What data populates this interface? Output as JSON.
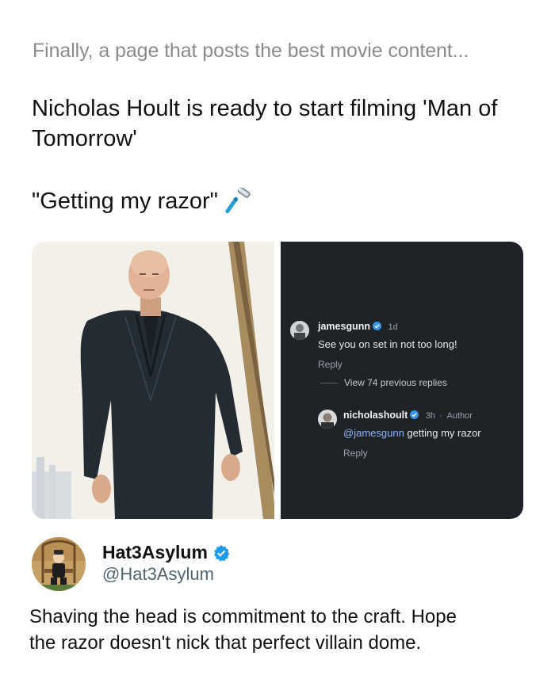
{
  "post": {
    "context_line": "Finally, a page that posts the best movie content...",
    "headline": "Nicholas Hoult is ready to start filming 'Man of Tomorrow'",
    "quote": "\"Getting my razor\"",
    "razor_icon": "razor-emoji"
  },
  "media": {
    "comments": [
      {
        "username": "jamesgunn",
        "verified": true,
        "age": "1d",
        "text": "See you on set in not too long!",
        "reply_label": "Reply"
      },
      {
        "username": "nicholashoult",
        "verified": true,
        "age": "3h",
        "role": "Author",
        "mention": "@jamesgunn",
        "text": "getting my razor",
        "reply_label": "Reply"
      }
    ],
    "view_replies": "View 74 previous replies",
    "separator": "·"
  },
  "reply": {
    "display_name": "Hat3Asylum",
    "handle": "@Hat3Asylum",
    "verified": true,
    "text": "Shaving the head is commitment to the craft. Hope the razor doesn't nick that perfect villain dome."
  },
  "colors": {
    "verified_blue": "#1d9bf0",
    "muted_text": "#8b8b8b",
    "dark_panel": "#1f2327",
    "mention_blue": "#8ab4f8"
  }
}
